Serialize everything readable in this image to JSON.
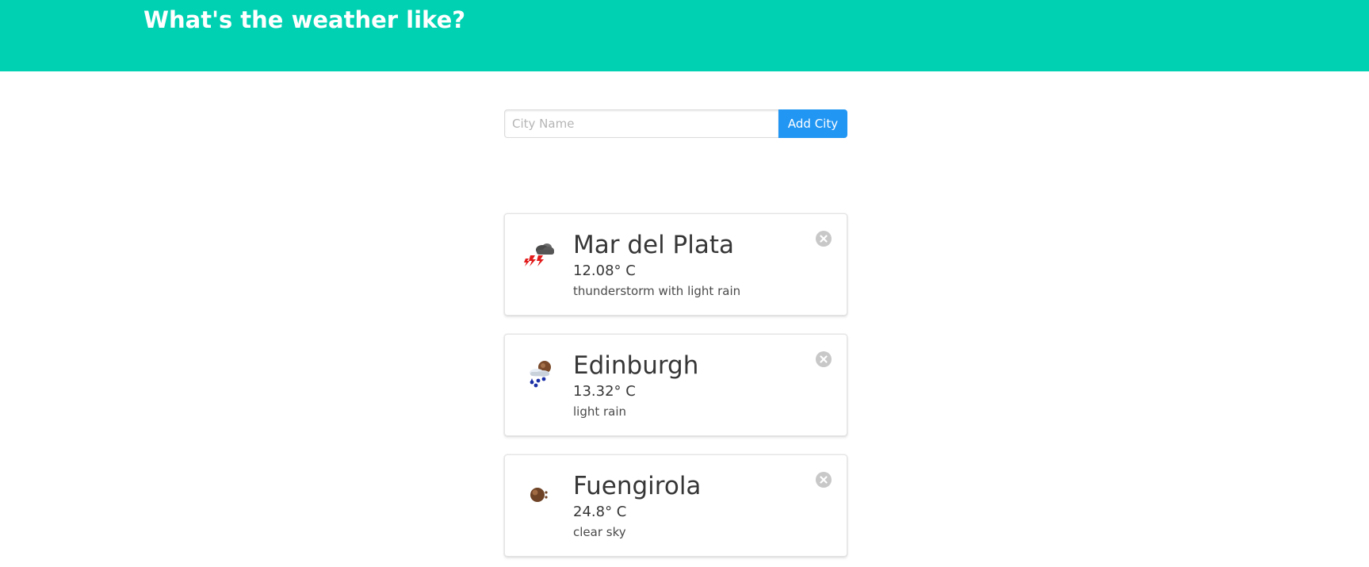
{
  "header": {
    "title": "What's the weather like?"
  },
  "search": {
    "placeholder": "City Name",
    "value": "",
    "button_label": "Add City"
  },
  "cities": [
    {
      "name": "Mar del Plata",
      "temperature": "12.08° C",
      "description": "thunderstorm with light rain",
      "icon": "thunderstorm-icon"
    },
    {
      "name": "Edinburgh",
      "temperature": "13.32° C",
      "description": "light rain",
      "icon": "light-rain-icon"
    },
    {
      "name": "Fuengirola",
      "temperature": "24.8° C",
      "description": "clear sky",
      "icon": "clear-sky-icon"
    }
  ],
  "colors": {
    "hero_background": "#00d1b2",
    "button_background": "#2196f3",
    "delete_button": "#c8c8c8"
  }
}
